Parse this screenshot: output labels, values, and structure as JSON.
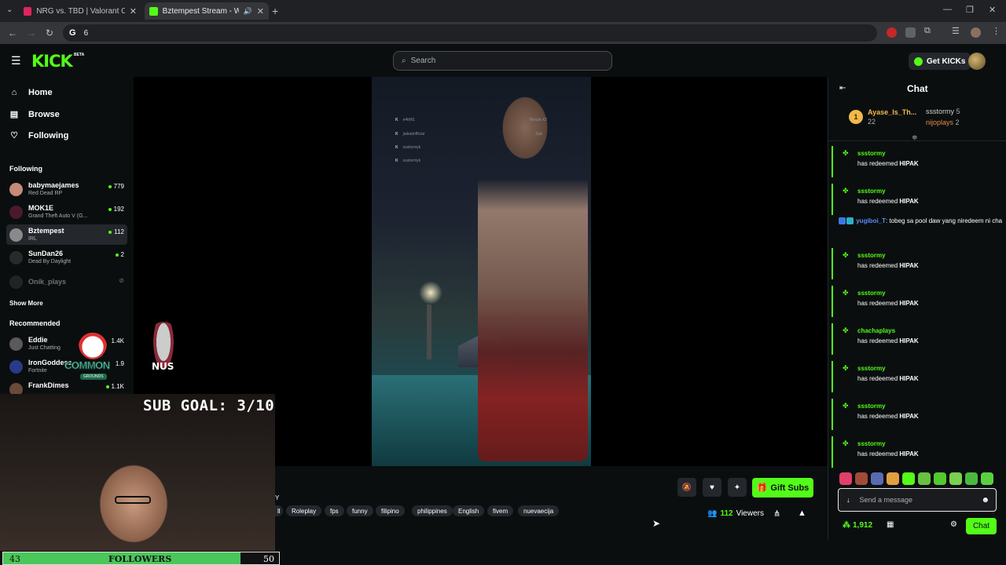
{
  "browser": {
    "tabs": [
      {
        "title": "NRG vs. TBD | Valorant Champi",
        "favicon_color": "#e0245e"
      },
      {
        "title": "Bztempest Stream - Watch",
        "favicon_color": "#53fc18"
      }
    ],
    "address": "6",
    "new_tab": "+",
    "close": "✕"
  },
  "header": {
    "logo": "KICK",
    "beta": "BETA",
    "search_placeholder": "Search",
    "get_kicks": "Get KICKs"
  },
  "sidebar": {
    "nav": [
      {
        "label": "Home",
        "icon": "home-icon"
      },
      {
        "label": "Browse",
        "icon": "browse-icon"
      },
      {
        "label": "Following",
        "icon": "heart-icon"
      }
    ],
    "following_heading": "Following",
    "following": [
      {
        "name": "babymaejames",
        "game": "Red Dead RP",
        "viewers": "779",
        "avatar": "#c58a7a"
      },
      {
        "name": "MOK1E",
        "game": "Grand Theft Auto V (G...",
        "viewers": "192",
        "avatar": "#4a1a2a"
      },
      {
        "name": "Bztempest",
        "game": "IRL",
        "viewers": "112",
        "avatar": "#8a8a8a"
      },
      {
        "name": "SunDan26",
        "game": "Dead By Daylight",
        "viewers": "2",
        "avatar": "#2a2a2a"
      },
      {
        "name": "Onik_plays",
        "game": "",
        "viewers": "",
        "avatar": "#3a3a3a"
      }
    ],
    "show_more": "Show More",
    "recommended_heading": "Recommended",
    "recommended": [
      {
        "name": "Eddie",
        "game": "Just Chatting",
        "viewers": "1.4K",
        "avatar": "#5a5a5a"
      },
      {
        "name": "IronGoddess",
        "game": "Fortnite",
        "viewers": "1.9",
        "avatar": "#2a3a8a"
      },
      {
        "name": "FrankDimes",
        "game": "",
        "viewers": "1.1K",
        "avatar": "#6a4a3a"
      }
    ]
  },
  "stream": {
    "overlay_rows": [
      "e4thft1",
      "jiabadofficial",
      "ssstormyk",
      "ssstormyk"
    ],
    "overlay_right": [
      "Resub X2",
      "Sub",
      "",
      ""
    ],
    "sub_goal": "SUB GOAL: 3/10",
    "common_logo": "COMMON",
    "common_sub": "GROUNDS",
    "game_badge": "NUS",
    "followers_current": "43",
    "followers_label": "FOLLOWERS",
    "followers_goal": "50",
    "followers_progress": 0.86
  },
  "info": {
    "tags": [
      "ll",
      "Roleplay",
      "fps",
      "funny",
      "filipino",
      "philippines",
      "English",
      "fivem",
      "nuevaecija"
    ],
    "gift_subs": "Gift Subs",
    "viewers_count": "112",
    "viewers_label": "Viewers",
    "fragment": "Y"
  },
  "chat": {
    "title": "Chat",
    "pinned": {
      "rank": "1",
      "top_user": "Ayase_Is_Th...",
      "top_count": "22",
      "user2": "ssstormy",
      "user2_count": "5",
      "user3": "nijoplays",
      "user3_count": "2"
    },
    "messages": [
      {
        "type": "redeem",
        "user": "ssstormy",
        "text": "has redeemed",
        "item": "HIPAK"
      },
      {
        "type": "redeem",
        "user": "ssstormy",
        "text": "has redeemed",
        "item": "HIPAK"
      },
      {
        "type": "text",
        "user": "yugiboi_T",
        "text": ": tobeg sa pool daw yang niredeem ni cha"
      },
      {
        "type": "redeem",
        "user": "ssstormy",
        "text": "has redeemed",
        "item": "HIPAK"
      },
      {
        "type": "redeem",
        "user": "ssstormy",
        "text": "has redeemed",
        "item": "HIPAK"
      },
      {
        "type": "redeem",
        "user": "chachaplays",
        "text": "has redeemed",
        "item": "HIPAK"
      },
      {
        "type": "redeem",
        "user": "ssstormy",
        "text": "has redeemed",
        "item": "HIPAK"
      },
      {
        "type": "redeem",
        "user": "ssstormy",
        "text": "has redeemed",
        "item": "HIPAK"
      },
      {
        "type": "redeem",
        "user": "ssstormy",
        "text": "has redeemed",
        "item": "HIPAK"
      }
    ],
    "input_placeholder": "Send a message",
    "kicks": "1,912",
    "send": "Chat"
  },
  "colors": {
    "accent": "#53fc18",
    "bg": "#0b0e0f"
  }
}
